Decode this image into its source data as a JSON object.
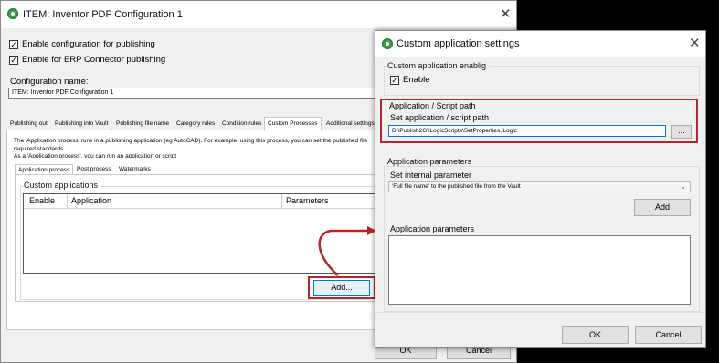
{
  "main": {
    "title": "ITEM: Inventor PDF Configuration 1",
    "enable_publishing": "Enable configuration for publishing",
    "enable_erp": "Enable for ERP Connector publishing",
    "config_name_label": "Configuration name:",
    "config_name_value": "ITEM: Inventor PDF Configuration 1",
    "tabs": [
      "Publishing out",
      "Publishing into Vault",
      "Publishing file name",
      "Category rules",
      "Condition rules",
      "Custom Processes",
      "Additional settings"
    ],
    "description_1": "The 'Application process' runs in a publishing application (eg AutoCAD). For example, using this process, you can set the published file",
    "description_2": "required standards.",
    "description_3": "As a 'Application process', you can run an application or script",
    "subtabs": [
      "Application process",
      "Post process",
      "Watermarks"
    ],
    "custom_apps_label": "Custom applications",
    "columns": [
      "Enable",
      "Application",
      "Parameters"
    ],
    "add_button": "Add...",
    "ok_button": "OK",
    "cancel_button": "Cancel"
  },
  "dialog": {
    "title": "Custom application settings",
    "enabling_group": "Custom application enablig",
    "enable_label": "Enable",
    "path_group": "Application / Script path",
    "path_label": "Set application / script path",
    "path_value": "D:\\Publish2G\\iLogicScripts\\SetProperties.iLogic",
    "browse_button": "...",
    "params_group": "Application parameters",
    "internal_label": "Set internal parameter",
    "internal_value": "'Full file name' to the published file from the Vault",
    "add_button": "Add",
    "app_params_label": "Application parameters",
    "ok_button": "OK",
    "cancel_button": "Cancel"
  },
  "colors": {
    "highlight": "#b3262d",
    "accent": "#3fa34d"
  }
}
